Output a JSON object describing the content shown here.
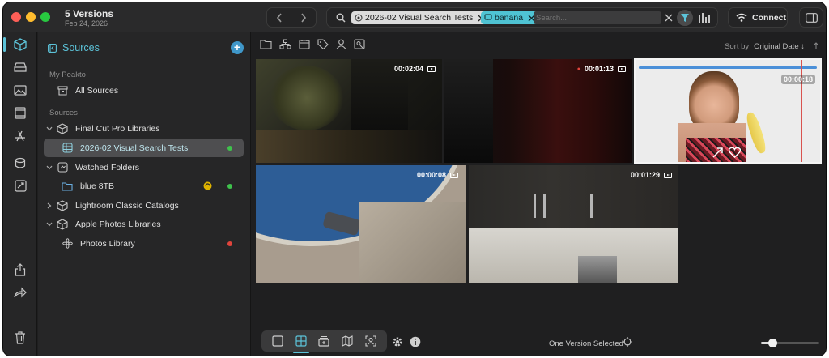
{
  "window": {
    "title": "5 Versions",
    "subtitle": "Feb 24, 2026"
  },
  "search": {
    "chip_library": "2026-02 Visual Search Tests",
    "chip_keyword": "banana",
    "placeholder": "Search..."
  },
  "toolbar": {
    "connect_label": "Connect"
  },
  "sidebar": {
    "header": "Sources",
    "section_mypeakto": "My Peakto",
    "all_sources": "All Sources",
    "section_sources": "Sources",
    "items": [
      {
        "label": "Final Cut Pro Libraries"
      },
      {
        "label": "2026-02 Visual Search Tests"
      },
      {
        "label": "Watched Folders"
      },
      {
        "label": "blue 8TB"
      },
      {
        "label": "Lightroom Classic Catalogs"
      },
      {
        "label": "Apple Photos Libraries"
      },
      {
        "label": "Photos Library"
      }
    ]
  },
  "content": {
    "sort_by_label": "Sort by",
    "sort_value": "Original Date ↕"
  },
  "tiles": [
    {
      "duration": "00:02:04"
    },
    {
      "duration": "00:01:13"
    },
    {
      "duration": "00:00:18"
    },
    {
      "duration": "00:00:08"
    },
    {
      "duration": "00:01:29"
    }
  ],
  "footer": {
    "status": "One Version Selected",
    "zoom_fraction": 0.2
  },
  "colors": {
    "accent": "#5cc3d9",
    "green_dot": "#3fc24c",
    "red_dot": "#e0443c",
    "badge_yellow": "#e0b400"
  }
}
